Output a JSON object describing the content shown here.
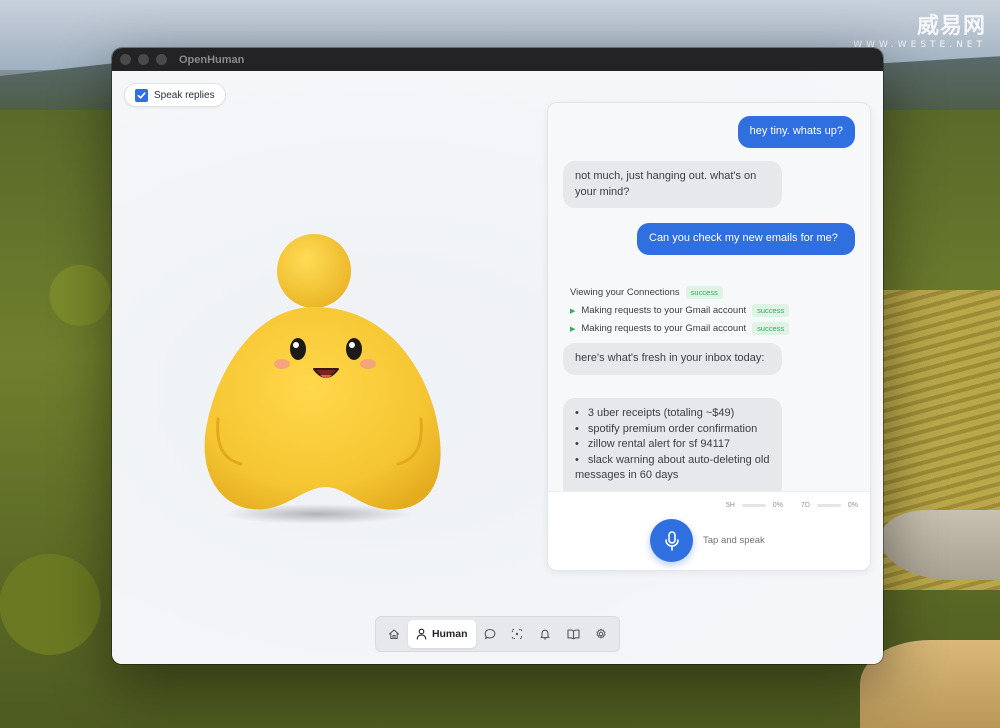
{
  "window": {
    "title": "OpenHuman"
  },
  "watermark": {
    "main": "威易网",
    "sub": "WWW.WESTE.NET"
  },
  "speak_replies": {
    "label": "Speak replies",
    "checked": true
  },
  "chat": {
    "messages": [
      {
        "role": "user",
        "text": "hey tiny. whats up?"
      },
      {
        "role": "assistant",
        "text": "not much, just hanging out. what's on your mind?"
      },
      {
        "role": "user",
        "text": "Can you check my new emails for me?"
      },
      {
        "role": "assistant",
        "text": "here's what's fresh in your inbox today:"
      },
      {
        "role": "assistant",
        "list": [
          "3 uber receipts (totaling ~$49)",
          "spotify premium order confirmation",
          "zillow rental alert for sf 94117",
          "slack warning about auto-deleting old messages in 60 days"
        ]
      }
    ],
    "tool_calls": [
      {
        "text": "Viewing your Connections",
        "status": "success"
      },
      {
        "text": "Making requests to your Gmail account",
        "status": "success"
      },
      {
        "text": "Making requests to your Gmail account",
        "status": "success"
      }
    ],
    "usage": {
      "label_5h": "5H",
      "value_5h": "0%",
      "label_7d": "7D",
      "value_7d": "0%"
    },
    "mic": {
      "label": "Tap and speak"
    }
  },
  "nav": {
    "items": [
      {
        "icon": "home-icon"
      },
      {
        "icon": "person-icon",
        "label": "Human",
        "active": true
      },
      {
        "icon": "chat-icon"
      },
      {
        "icon": "scan-icon"
      },
      {
        "icon": "bell-icon"
      },
      {
        "icon": "book-icon"
      },
      {
        "icon": "gear-icon"
      }
    ]
  },
  "colors": {
    "accent": "#2f6fe0",
    "success": "#3aa866",
    "mascot": "#f6c93a"
  }
}
